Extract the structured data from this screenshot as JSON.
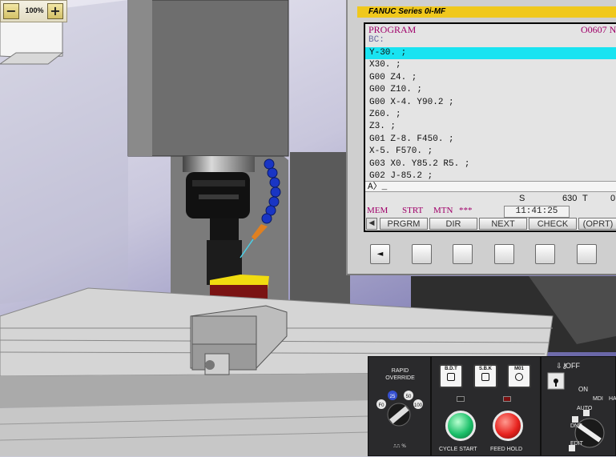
{
  "zoom": {
    "minus": "−",
    "level": "100%",
    "plus": "+"
  },
  "cnc": {
    "brand": "FANUC Series 0i-MF",
    "screen": {
      "mode_title": "PROGRAM",
      "program_number": "O0607  N",
      "block_label": "BC:",
      "lines": [
        "Y-30. ;",
        "X30. ;",
        "G00 Z4. ;",
        "G00 Z10. ;",
        "G00 X-4. Y90.2 ;",
        "Z60. ;",
        "Z3. ;",
        "G01 Z-8. F450. ;",
        "X-5. F570. ;",
        "G03 X0. Y85.2 R5. ;",
        "G02 J-85.2 ;"
      ],
      "highlighted_line": 0,
      "input_prompt": "A〉_",
      "spindle_label": "S",
      "spindle_value": "630",
      "tool_label": "T",
      "tool_value": "0",
      "status_mode": "MEM",
      "status_run": "STRT",
      "status_motion": "MTN",
      "status_alarm": "***",
      "clock": "11:41:25",
      "softkeys": [
        "PRGRM",
        "DIR",
        "NEXT",
        "CHECK",
        "(OPRT)"
      ],
      "softkey_back": "◀"
    },
    "hard_buttons": [
      "◄",
      "",
      "",
      "",
      "",
      ""
    ]
  },
  "panel": {
    "rapid_override_label": "RAPID\nOVERRIDE",
    "rapid_marks": [
      "F0",
      "25",
      "50",
      "100"
    ],
    "rapid_units": "⎍⎍ %",
    "keys": [
      {
        "label": "B.D.T"
      },
      {
        "label": "S.B.K"
      },
      {
        "label": "M01"
      }
    ],
    "cycle_start_label": "CYCLE START",
    "feed_hold_label": "FEED HOLD",
    "key_off": "OFF",
    "key_on": "ON",
    "mode_labels": [
      "MDI",
      "HA",
      "AUTO",
      "DNC",
      "EDIT"
    ],
    "colors": {
      "cycle_start": "#1cc06a",
      "feed_hold": "#e8231f",
      "brand_bar": "#f0c81c",
      "highlight": "#19e3f1"
    }
  }
}
